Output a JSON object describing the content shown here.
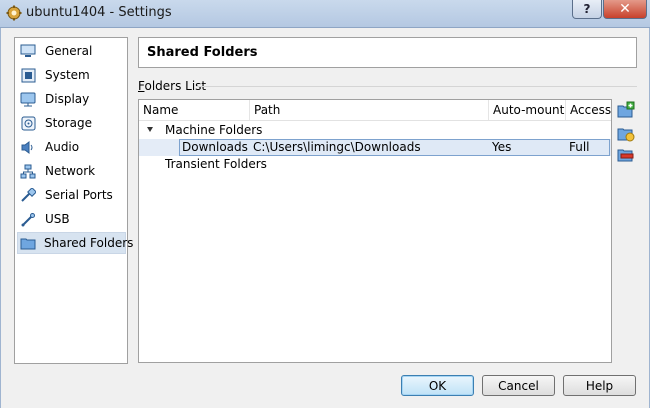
{
  "window": {
    "title": "ubuntu1404 - Settings",
    "help_glyph": "?",
    "close_glyph": "✕"
  },
  "sidebar": {
    "items": [
      {
        "label": "General",
        "icon": "general-icon"
      },
      {
        "label": "System",
        "icon": "system-icon"
      },
      {
        "label": "Display",
        "icon": "display-icon"
      },
      {
        "label": "Storage",
        "icon": "storage-icon"
      },
      {
        "label": "Audio",
        "icon": "audio-icon"
      },
      {
        "label": "Network",
        "icon": "network-icon"
      },
      {
        "label": "Serial Ports",
        "icon": "serial-ports-icon"
      },
      {
        "label": "USB",
        "icon": "usb-icon"
      },
      {
        "label": "Shared Folders",
        "icon": "shared-folders-icon",
        "selected": true
      }
    ]
  },
  "page": {
    "title": "Shared Folders",
    "group_label": "Folders List"
  },
  "table": {
    "columns": [
      "Name",
      "Path",
      "Auto-mount",
      "Access"
    ],
    "groups": [
      {
        "label": "Machine Folders",
        "expanded": true,
        "rows": [
          {
            "name": "Downloads",
            "path": "C:\\Users\\limingc\\Downloads",
            "auto_mount": "Yes",
            "access": "Full",
            "selected": true
          }
        ]
      },
      {
        "label": "Transient Folders",
        "expanded": false,
        "rows": []
      }
    ]
  },
  "tools": {
    "add": "add-folder-icon",
    "edit": "edit-folder-icon",
    "remove": "remove-folder-icon"
  },
  "buttons": {
    "ok": "OK",
    "cancel": "Cancel",
    "help": "Help"
  },
  "colors": {
    "selection": "#dfe9f6",
    "selection_border": "#7da2ce",
    "dialog_bg": "#f0f0f0"
  }
}
